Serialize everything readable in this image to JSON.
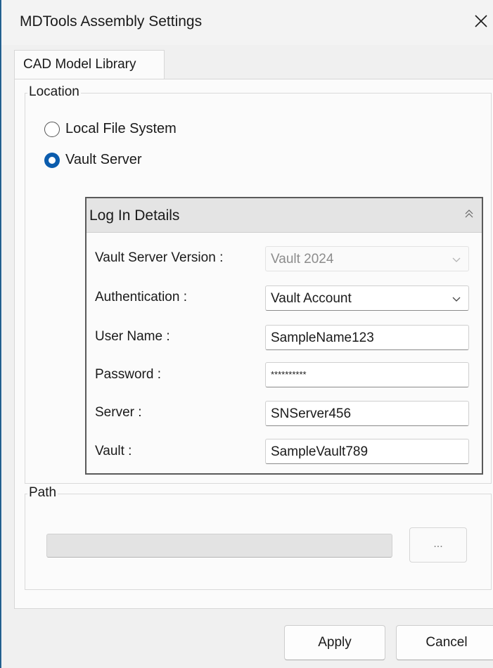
{
  "window": {
    "title": "MDTools Assembly Settings"
  },
  "tabs": [
    {
      "label": "CAD Model Library"
    }
  ],
  "location": {
    "legend": "Location",
    "options": [
      {
        "label": "Local File System",
        "selected": false
      },
      {
        "label": "Vault Server",
        "selected": true
      }
    ]
  },
  "login": {
    "title": "Log In Details",
    "fields": [
      {
        "label": "Vault Server Version :",
        "value": "Vault 2024",
        "type": "dropdown",
        "disabled": true
      },
      {
        "label": "Authentication :",
        "value": "Vault Account",
        "type": "dropdown",
        "disabled": false
      },
      {
        "label": "User Name :",
        "value": "SampleName123",
        "type": "text",
        "disabled": false
      },
      {
        "label": "Password :",
        "value": "**********",
        "type": "password",
        "disabled": false
      },
      {
        "label": "Server :",
        "value": "SNServer456",
        "type": "text",
        "disabled": false
      },
      {
        "label": "Vault :",
        "value": "SampleVault789",
        "type": "text",
        "disabled": false
      }
    ]
  },
  "path": {
    "legend": "Path",
    "value": "",
    "browse_label": "..."
  },
  "buttons": {
    "apply": "Apply",
    "cancel": "Cancel"
  },
  "colors": {
    "accent": "#0b5cad",
    "desktop": "#1f5a84"
  }
}
